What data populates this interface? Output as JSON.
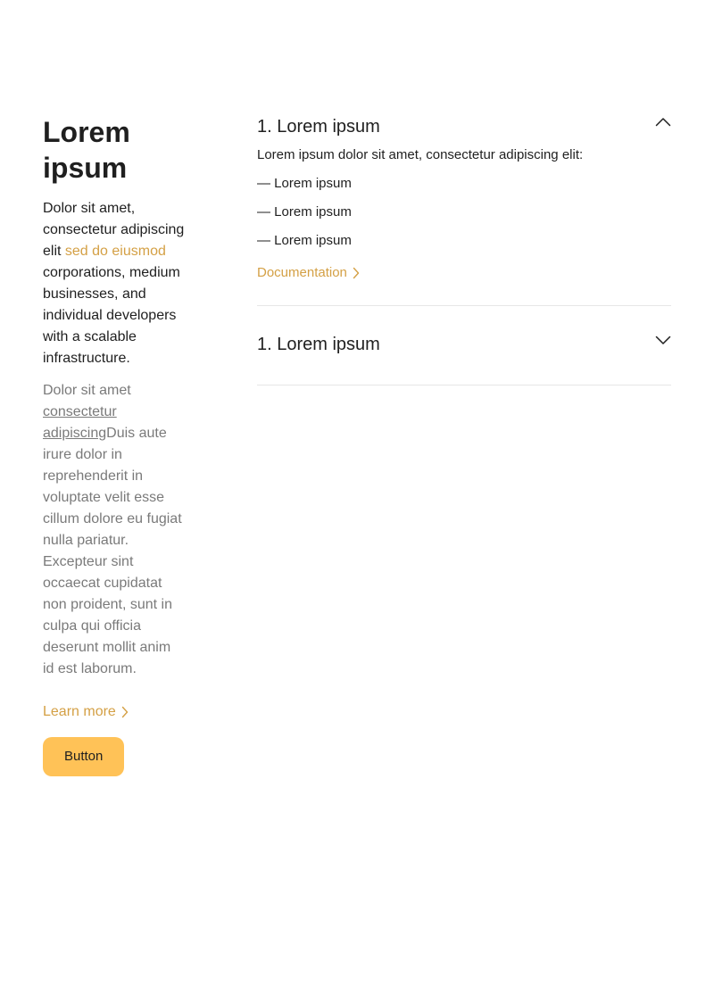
{
  "left": {
    "title_line1": "Lorem",
    "title_line2": "ipsum",
    "lead": {
      "part1": "Dolor sit amet, consectetur adipiscing elit ",
      "accent": "sed do eiusmod",
      "part2": " corporations, medium businesses, and individual developers with a scalable ",
      "strong": "infrastructure",
      "part3": "."
    },
    "body": {
      "part1": "Dolor sit amet ",
      "underlined": "consectetur adipiscing",
      "part2": "Duis aute irure dolor in reprehenderit in voluptate velit esse cillum dolore eu fugiat nulla pariatur. Excepteur sint occaecat cupidatat non proident, sunt in culpa qui officia deserunt mollit anim id est laborum."
    },
    "learn_more_label": "Learn more",
    "button_label": "Button"
  },
  "accordion": {
    "items": [
      {
        "title": "1. Lorem ipsum",
        "expanded": true,
        "intro": "Lorem ipsum dolor sit amet, consectetur adipiscing elit:",
        "list": [
          "— Lorem ipsum",
          "— Lorem ipsum",
          "— Lorem ipsum"
        ],
        "link_label": "Documentation"
      },
      {
        "title": "1. Lorem ipsum",
        "expanded": false
      }
    ]
  },
  "colors": {
    "accent": "#d4a045",
    "button": "#ffc257",
    "text": "#1f1f1f",
    "muted": "#7a7a7a",
    "divider": "#e6e6e6"
  },
  "icons": {
    "learn_more": "chevron-right-icon",
    "documentation": "chevron-right-icon",
    "expanded": "chevron-up-icon",
    "collapsed": "chevron-down-icon"
  }
}
